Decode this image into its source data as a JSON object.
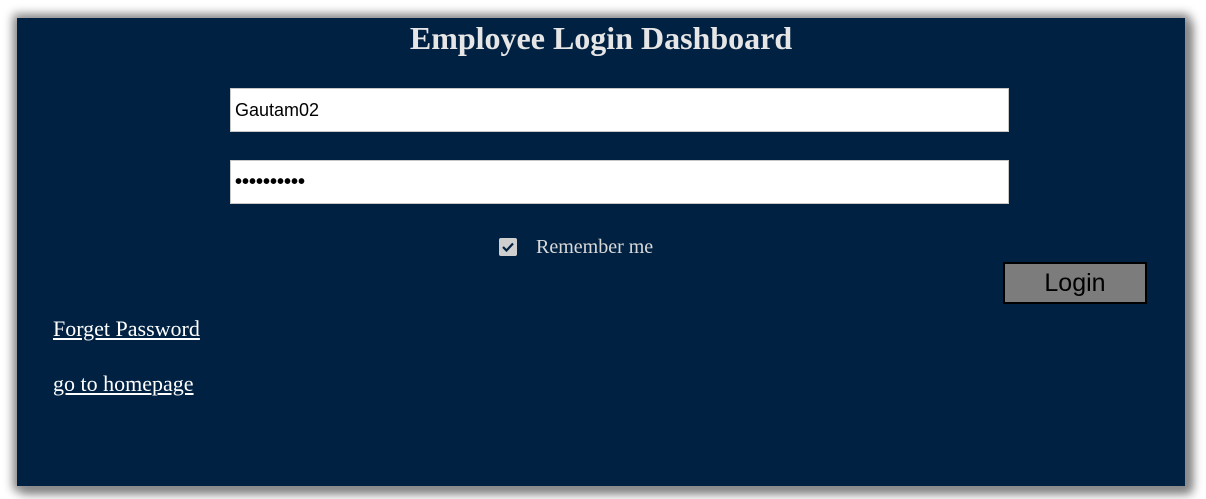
{
  "page": {
    "title": "Employee Login Dashboard"
  },
  "form": {
    "username_value": "Gautam02",
    "password_mask": "••••••••••",
    "remember_label": "Remember me",
    "remember_checked": true,
    "login_label": "Login"
  },
  "links": {
    "forget_password": "Forget Password",
    "homepage": "go to homepage"
  },
  "colors": {
    "panel_background": "#002142",
    "button_background": "#7c7c7c",
    "text_light": "#e6e6e6"
  },
  "icons": {
    "checkbox": "checkmark-icon"
  }
}
